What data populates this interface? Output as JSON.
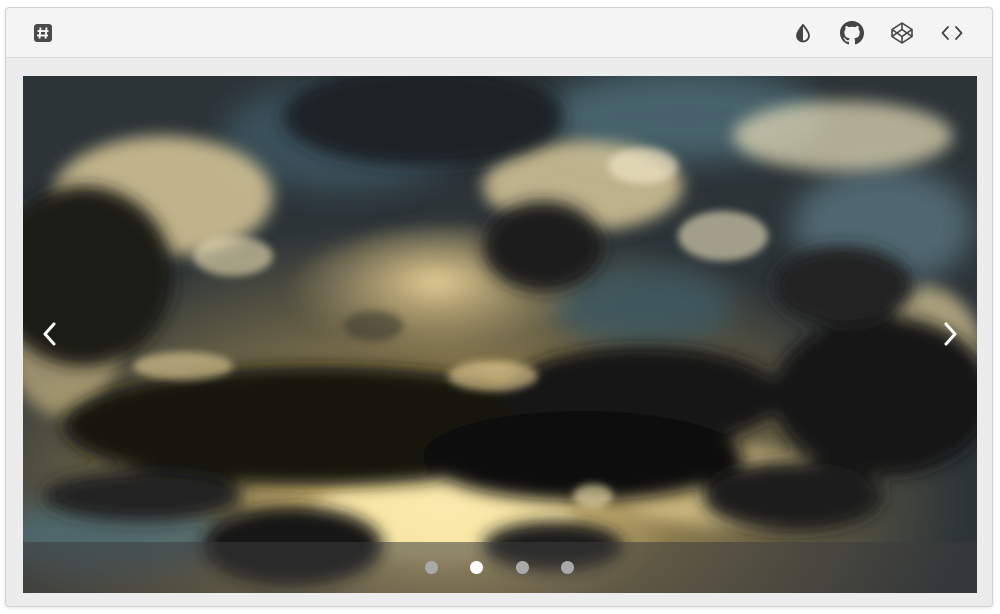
{
  "toolbar": {
    "left_icon": "hash-icon",
    "right_icons": [
      "contrast-icon",
      "github-icon",
      "codepen-icon",
      "code-icon"
    ]
  },
  "slider": {
    "image": "cloudy-sky-sunset",
    "arrows": [
      "chevron-left-icon",
      "chevron-right-icon"
    ],
    "slide_count": 4,
    "active_slide_index": 1
  },
  "colors": {
    "toolbar_bg": "#f4f4f4",
    "frame_bg": "#ececec",
    "icon_color": "#444444",
    "dot_inactive": "#a9a9a9",
    "dot_active": "#ffffff"
  }
}
